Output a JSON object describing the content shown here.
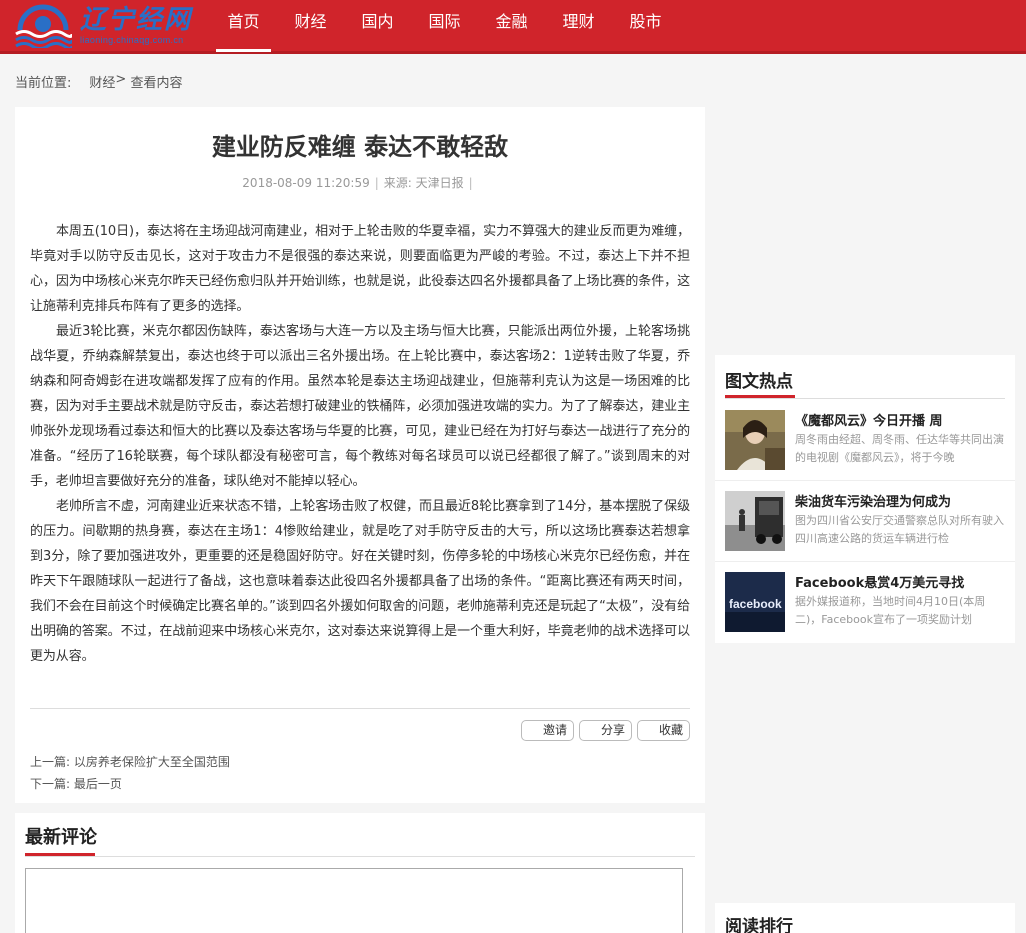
{
  "header": {
    "logo_title": "辽宁经网",
    "logo_url": "liaoning.chinaqg.com.cn",
    "nav": [
      "首页",
      "财经",
      "国内",
      "国际",
      "金融",
      "理财",
      "股市"
    ]
  },
  "breadcrumb": {
    "label": "当前位置:",
    "section": "财经",
    "arrow": ">",
    "current": "查看内容"
  },
  "article": {
    "title": "建业防反难缠 泰达不敢轻敌",
    "date": "2018-08-09 11:20:59",
    "separator": "|",
    "source": "来源: 天津日报",
    "paragraphs": [
      "本周五(10日)，泰达将在主场迎战河南建业，相对于上轮击败的华夏幸福，实力不算强大的建业反而更为难缠，毕竟对手以防守反击见长，这对于攻击力不是很强的泰达来说，则要面临更为严峻的考验。不过，泰达上下并不担心，因为中场核心米克尔昨天已经伤愈归队并开始训练，也就是说，此役泰达四名外援都具备了上场比赛的条件，这让施蒂利克排兵布阵有了更多的选择。",
      "最近3轮比赛，米克尔都因伤缺阵，泰达客场与大连一方以及主场与恒大比赛，只能派出两位外援，上轮客场挑战华夏，乔纳森解禁复出，泰达也终于可以派出三名外援出场。在上轮比赛中，泰达客场2：1逆转击败了华夏，乔纳森和阿奇姆彭在进攻端都发挥了应有的作用。虽然本轮是泰达主场迎战建业，但施蒂利克认为这是一场困难的比赛，因为对手主要战术就是防守反击，泰达若想打破建业的铁桶阵，必须加强进攻端的实力。为了了解泰达，建业主帅张外龙现场看过泰达和恒大的比赛以及泰达客场与华夏的比赛，可见，建业已经在为打好与泰达一战进行了充分的准备。“经历了16轮联赛，每个球队都没有秘密可言，每个教练对每名球员可以说已经都很了解了。”谈到周末的对手，老帅坦言要做好充分的准备，球队绝对不能掉以轻心。",
      "老帅所言不虚，河南建业近来状态不错，上轮客场击败了权健，而且最近8轮比赛拿到了14分，基本摆脱了保级的压力。间歇期的热身赛，泰达在主场1：4惨败给建业，就是吃了对手防守反击的大亏，所以这场比赛泰达若想拿到3分，除了要加强进攻外，更重要的还是稳固好防守。好在关键时刻，伤停多轮的中场核心米克尔已经伤愈，并在昨天下午跟随球队一起进行了备战，这也意味着泰达此役四名外援都具备了出场的条件。“距离比赛还有两天时间，我们不会在目前这个时候确定比赛名单的。”谈到四名外援如何取舍的问题，老帅施蒂利克还是玩起了“太极”，没有给出明确的答案。不过，在战前迎来中场核心米克尔，这对泰达来说算得上是一个重大利好，毕竟老帅的战术选择可以更为从容。"
    ],
    "actions": [
      "邀请",
      "分享",
      "收藏"
    ],
    "prev_label": "上一篇:",
    "prev_title": "以房养老保险扩大至全国范围",
    "next_label": "下一篇:",
    "next_title": "最后一页"
  },
  "comments": {
    "title": "最新评论"
  },
  "sidebar": {
    "hot_title": "图文热点",
    "hot_items": [
      {
        "title": "《魔都风云》今日开播 周",
        "desc": "周冬雨由经超、周冬雨、任达华等共同出演的电视剧《魔都风云》，将于今晚"
      },
      {
        "title": "柴油货车污染治理为何成为",
        "desc": "图为四川省公安厅交通警察总队对所有驶入四川高速公路的货运车辆进行检"
      },
      {
        "title": "Facebook悬赏4万美元寻找",
        "desc": "据外媒报道称，当地时间4月10日(本周二)，Facebook宣布了一项奖励计划"
      }
    ],
    "read_rank_title": "阅读排行"
  },
  "colors": {
    "brand_red": "#d0242b",
    "logo_blue": "#2a6fc6"
  }
}
